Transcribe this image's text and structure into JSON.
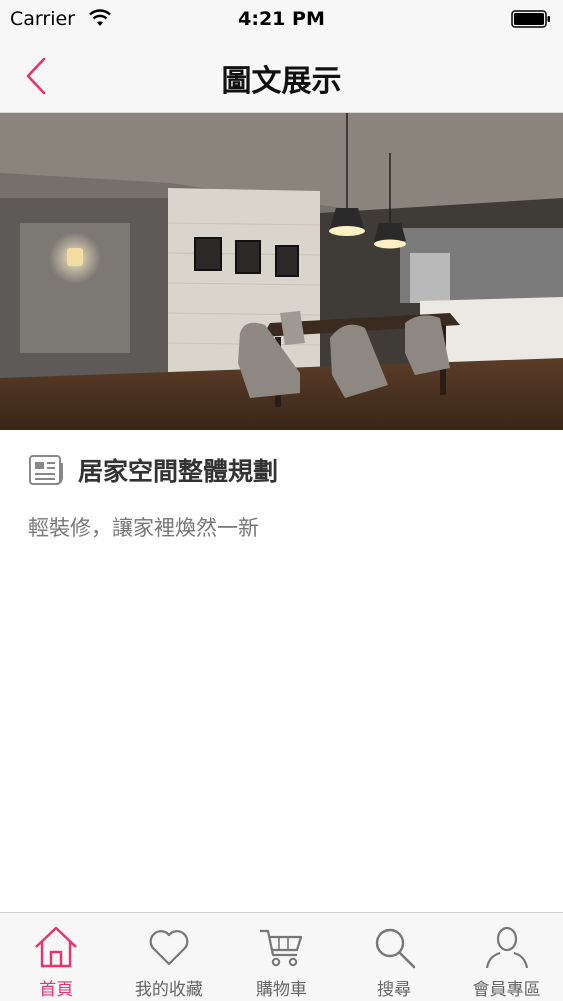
{
  "status_bar": {
    "carrier": "Carrier",
    "time": "4:21 PM"
  },
  "nav": {
    "title": "圖文展示",
    "back_icon": "chevron-left-icon"
  },
  "hero": {
    "alt": "dining-room-photo"
  },
  "article": {
    "title": "居家空間整體規劃",
    "subtitle": "輕裝修，讓家裡煥然一新",
    "icon": "document-icon"
  },
  "tabs": [
    {
      "label": "首頁",
      "icon": "home-icon",
      "active": true
    },
    {
      "label": "我的收藏",
      "icon": "heart-icon",
      "active": false
    },
    {
      "label": "購物車",
      "icon": "cart-icon",
      "active": false
    },
    {
      "label": "搜尋",
      "icon": "search-icon",
      "active": false
    },
    {
      "label": "會員專區",
      "icon": "user-icon",
      "active": false
    }
  ],
  "colors": {
    "accent": "#e8336b",
    "inactive": "#666666",
    "bar": "#f7f7f7"
  }
}
